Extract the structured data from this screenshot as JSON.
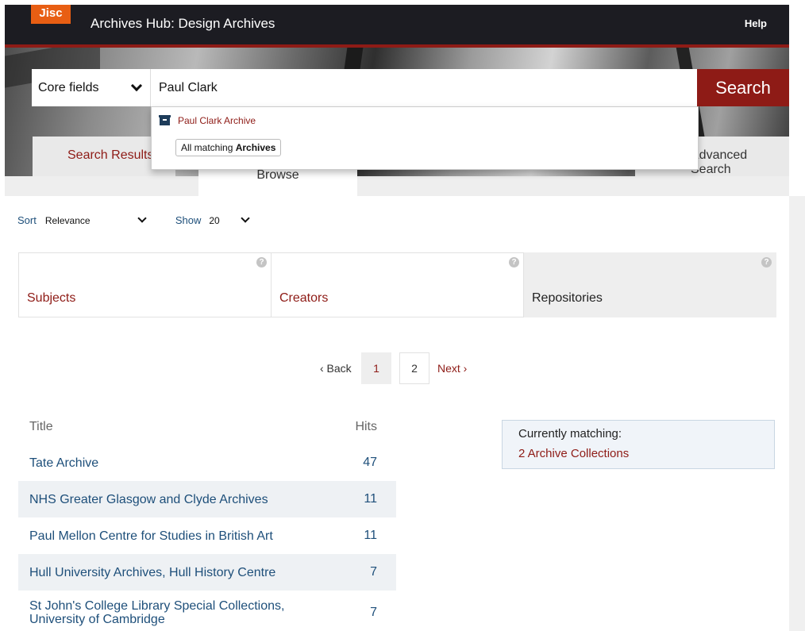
{
  "header": {
    "logo": "Jisc",
    "title": "Archives Hub: Design Archives",
    "help": "Help"
  },
  "search": {
    "field_select": "Core fields",
    "query": "Paul Clark",
    "button": "Search"
  },
  "tabs": {
    "search_results": "Search Results",
    "browse": "Browse",
    "advanced": "Advanced Search"
  },
  "autocomplete": {
    "item": "Paul Clark Archive",
    "all_prefix": "All matching ",
    "all_bold": "Archives"
  },
  "sort": {
    "label": "Sort",
    "value": "Relevance",
    "show_label": "Show",
    "show_value": "20"
  },
  "facets": [
    {
      "label": "Subjects"
    },
    {
      "label": "Creators"
    },
    {
      "label": "Repositories"
    }
  ],
  "pagination": {
    "back": "‹ Back",
    "pages": [
      "1",
      "2"
    ],
    "current": "1",
    "next": "Next ›"
  },
  "results": {
    "col_title": "Title",
    "col_hits": "Hits",
    "rows": [
      {
        "title": "Tate Archive",
        "hits": "47"
      },
      {
        "title": "NHS Greater Glasgow and Clyde Archives",
        "hits": "11"
      },
      {
        "title": "Paul Mellon Centre for Studies in British Art",
        "hits": "11"
      },
      {
        "title": "Hull University Archives, Hull History Centre",
        "hits": "7"
      },
      {
        "title": "St John's College Library Special Collections, University of Cambridge",
        "hits": "7"
      }
    ]
  },
  "matching": {
    "label": "Currently matching:",
    "link": "2 Archive Collections"
  },
  "colors": {
    "brand_red": "#8e1b16",
    "jisc_orange": "#e85e13",
    "link_blue": "#1e4f7a",
    "topbar": "#1c1c22"
  },
  "icons": {
    "archive": "archive-box-icon",
    "help": "question-circle-icon",
    "dropdown": "chevron-down-icon"
  }
}
